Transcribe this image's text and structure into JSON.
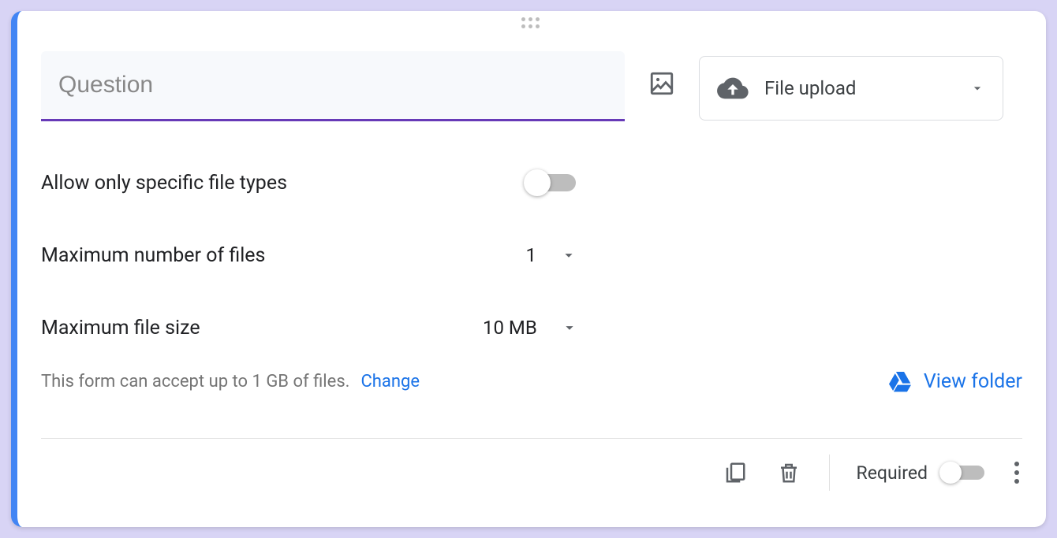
{
  "question": {
    "placeholder": "Question",
    "value": ""
  },
  "type_selector": {
    "label": "File upload"
  },
  "settings": {
    "allow_specific_label": "Allow only specific file types",
    "allow_specific_on": false,
    "max_files_label": "Maximum number of files",
    "max_files_value": "1",
    "max_size_label": "Maximum file size",
    "max_size_value": "10 MB"
  },
  "info": {
    "text": "This form can accept up to 1 GB of files.",
    "change_label": "Change",
    "view_folder_label": "View folder"
  },
  "footer": {
    "required_label": "Required",
    "required_on": false
  }
}
